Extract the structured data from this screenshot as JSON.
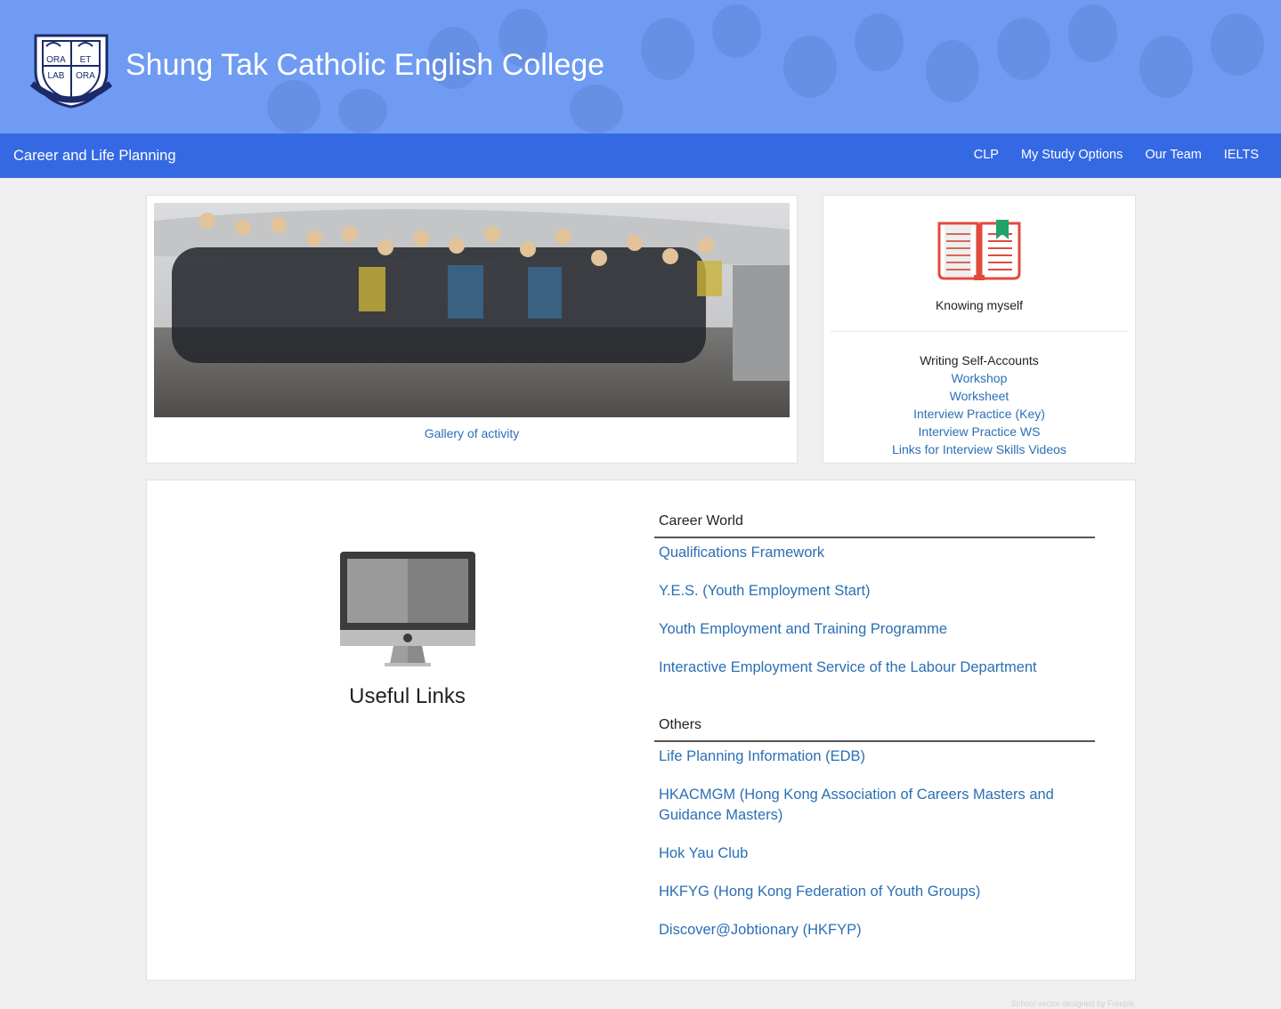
{
  "header": {
    "title": "Shung Tak Catholic English College",
    "crest_lettering": [
      "ORA",
      "ET",
      "LAB",
      "ORA"
    ]
  },
  "nav": {
    "brand": "Career and Life Planning",
    "items": [
      {
        "label": "CLP"
      },
      {
        "label": "My Study Options"
      },
      {
        "label": "Our Team"
      },
      {
        "label": "IELTS"
      }
    ]
  },
  "gallery": {
    "link_label": "Gallery of activity"
  },
  "knowing_myself": {
    "title": "Knowing myself",
    "subheading": "Writing Self-Accounts",
    "links": [
      {
        "label": "Workshop"
      },
      {
        "label": "Worksheet"
      },
      {
        "label": "Interview Practice (Key)"
      },
      {
        "label": "Interview Practice WS"
      },
      {
        "label": "Links for Interview Skills Videos"
      }
    ]
  },
  "useful_links": {
    "title": "Useful Links",
    "career_world": {
      "heading": "Career World",
      "links": [
        {
          "label": "Qualifications Framework"
        },
        {
          "label": "Y.E.S. (Youth Employment Start)"
        },
        {
          "label": "Youth Employment and Training Programme"
        },
        {
          "label": "Interactive Employment Service of the Labour Department"
        }
      ]
    },
    "others": {
      "heading": "Others",
      "links": [
        {
          "label": "Life Planning Information (EDB)"
        },
        {
          "label": "HKACMGM (Hong Kong Association of Careers Masters and Guidance Masters)"
        },
        {
          "label": "Hok Yau Club"
        },
        {
          "label": "HKFYG (Hong Kong Federation of Youth Groups)"
        },
        {
          "label": "Discover@Jobtionary (HKFYP)"
        }
      ]
    }
  },
  "footer": {
    "credit": "School vector designed by Freepik"
  },
  "colors": {
    "banner": "#6f9cf2",
    "nav": "#3569e4",
    "link": "#2a6fb5",
    "page_bg": "#efefef"
  },
  "icons": {
    "crest": "school-crest-icon",
    "book": "open-book-icon",
    "monitor": "desktop-monitor-icon"
  }
}
